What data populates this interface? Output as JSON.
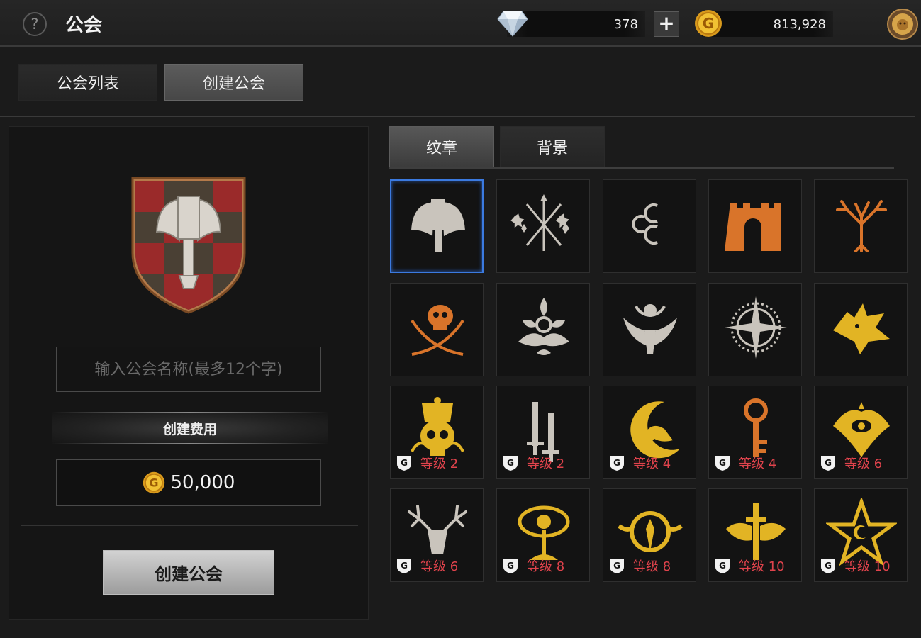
{
  "topbar": {
    "title": "公会",
    "help_icon": "question-icon",
    "gems": "378",
    "gold": "813,928",
    "plus_label": "+",
    "gem_icon": "diamond-icon",
    "gold_icon": "gold-coin-icon",
    "profile_icon": "lion-badge-icon"
  },
  "main_tabs": [
    {
      "label": "公会列表",
      "active": false
    },
    {
      "label": "创建公会",
      "active": true
    }
  ],
  "create_panel": {
    "name_placeholder": "输入公会名称(最多12个字)",
    "fee_label": "创建费用",
    "fee_amount": "50,000",
    "create_button": "创建公会"
  },
  "sub_tabs": [
    {
      "label": "纹章",
      "active": true
    },
    {
      "label": "背景",
      "active": false
    }
  ],
  "emblems": [
    {
      "name": "axe",
      "color": "#c9c4bc",
      "selected": true,
      "level": ""
    },
    {
      "name": "arrows-stars",
      "color": "#c9c4bc",
      "selected": false,
      "level": ""
    },
    {
      "name": "crescents",
      "color": "#c9c4bc",
      "selected": false,
      "level": ""
    },
    {
      "name": "castle-gate",
      "color": "#d9742a",
      "selected": false,
      "level": ""
    },
    {
      "name": "tree",
      "color": "#d9742a",
      "selected": false,
      "level": ""
    },
    {
      "name": "skull-swords",
      "color": "#d9742a",
      "selected": false,
      "level": ""
    },
    {
      "name": "flourish",
      "color": "#c9c4bc",
      "selected": false,
      "level": ""
    },
    {
      "name": "phoenix",
      "color": "#c9c4bc",
      "selected": false,
      "level": ""
    },
    {
      "name": "compass-star",
      "color": "#c9c4bc",
      "selected": false,
      "level": ""
    },
    {
      "name": "wolf-head",
      "color": "#e2b424",
      "selected": false,
      "level": ""
    },
    {
      "name": "crowned-skull",
      "color": "#e2b424",
      "selected": false,
      "level": "等级 2"
    },
    {
      "name": "swords",
      "color": "#c9c4bc",
      "selected": false,
      "level": "等级 2"
    },
    {
      "name": "crescent-raven",
      "color": "#e2b424",
      "selected": false,
      "level": "等级 4"
    },
    {
      "name": "key",
      "color": "#d9742a",
      "selected": false,
      "level": "等级 4"
    },
    {
      "name": "eye-ornament",
      "color": "#e2b424",
      "selected": false,
      "level": "等级 6"
    },
    {
      "name": "stag-head",
      "color": "#c9c4bc",
      "selected": false,
      "level": "等级 6"
    },
    {
      "name": "golden-tree",
      "color": "#e2b424",
      "selected": false,
      "level": "等级 8"
    },
    {
      "name": "ring-wings",
      "color": "#e2b424",
      "selected": false,
      "level": "等级 8"
    },
    {
      "name": "winged-sword",
      "color": "#e2b424",
      "selected": false,
      "level": "等级 10"
    },
    {
      "name": "pentagram-moon",
      "color": "#e2b424",
      "selected": false,
      "level": "等级 10"
    }
  ]
}
